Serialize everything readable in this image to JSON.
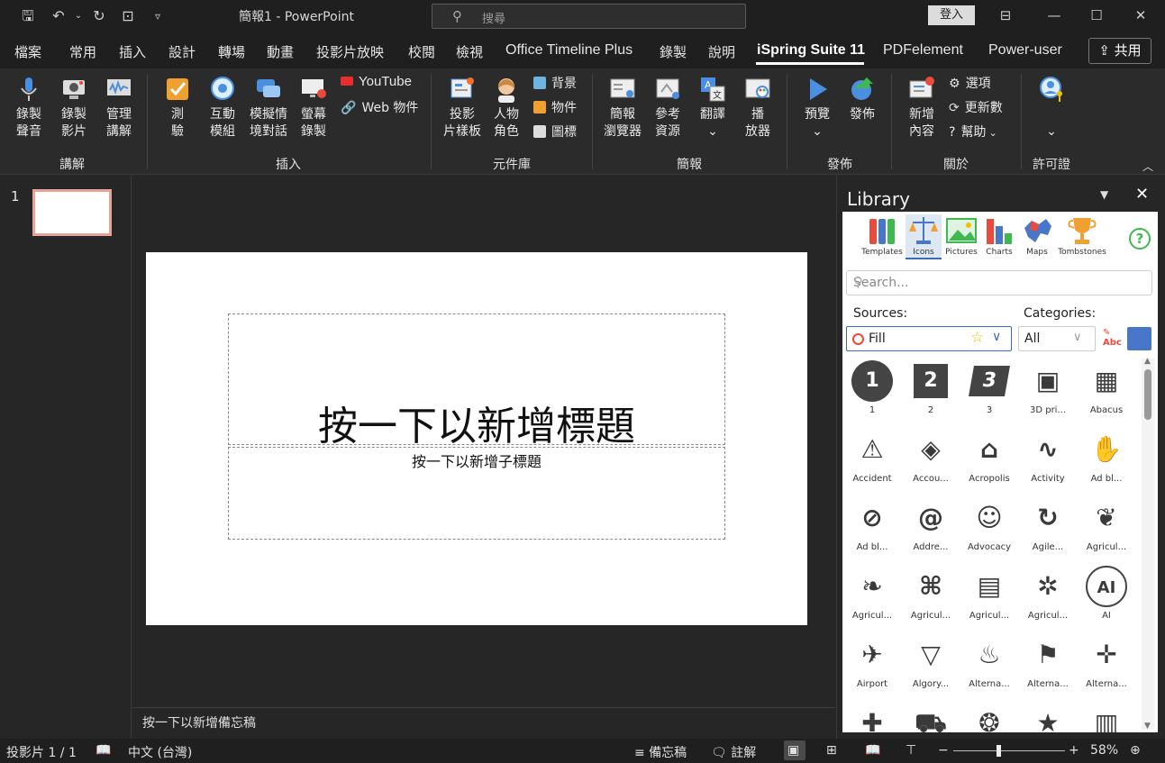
{
  "titlebar": {
    "title": "簡報1  -  PowerPoint",
    "search_placeholder": "搜尋",
    "signin": "登入"
  },
  "menu": {
    "tabs": [
      "檔案",
      "常用",
      "插入",
      "設計",
      "轉場",
      "動畫",
      "投影片放映",
      "校閱",
      "檢視",
      "Office Timeline Plus",
      "錄製",
      "說明",
      "iSpring Suite 11",
      "PDFelement",
      "Power-user"
    ],
    "active": "iSpring Suite 11",
    "share": "共用"
  },
  "ribbon": {
    "groups": {
      "narration": {
        "label": "講解",
        "buttons": [
          [
            "錄製",
            "聲音"
          ],
          [
            "錄製",
            "影片"
          ],
          [
            "管理",
            "講解"
          ]
        ]
      },
      "insert": {
        "label": "插入",
        "buttons": [
          [
            "測",
            "驗"
          ],
          [
            "互動",
            "模組"
          ],
          [
            "模擬情",
            "境對話"
          ],
          [
            "螢幕",
            "錄製"
          ]
        ],
        "small": [
          "YouTube",
          "Web 物件"
        ]
      },
      "library": {
        "label": "元件庫",
        "buttons": [
          [
            "投影",
            "片樣板"
          ],
          [
            "人物",
            "角色"
          ]
        ],
        "small": [
          "背景",
          "物件",
          "圖標"
        ]
      },
      "presentation": {
        "label": "簡報",
        "buttons": [
          [
            "簡報",
            "瀏覽器"
          ],
          [
            "參考",
            "資源"
          ],
          [
            "翻譯",
            ""
          ],
          [
            "播",
            "放器"
          ]
        ]
      },
      "publish": {
        "label": "發佈",
        "buttons": [
          [
            "預覽",
            ""
          ],
          [
            "發佈",
            ""
          ]
        ]
      },
      "about": {
        "label": "關於",
        "buttons": [
          [
            "新增",
            "內容"
          ]
        ],
        "small": [
          "選項",
          "更新數",
          "幫助"
        ]
      },
      "license": {
        "label": "許可證"
      }
    }
  },
  "thumbnails": {
    "number": "1"
  },
  "slide": {
    "title_placeholder": "按一下以新增標題",
    "subtitle_placeholder": "按一下以新增子標題"
  },
  "notes": {
    "placeholder": "按一下以新增備忘稿"
  },
  "library": {
    "title": "Library",
    "tabs": [
      "Templates",
      "Icons",
      "Pictures",
      "Charts",
      "Maps",
      "Tombstones"
    ],
    "active_tab": "Icons",
    "search_placeholder": "Search...",
    "sources_label": "Sources:",
    "categories_label": "Categories:",
    "source_value": "Fill",
    "category_value": "All",
    "accent_color": "#4876c8",
    "icons": [
      {
        "label": "1",
        "glyph": "1"
      },
      {
        "label": "2",
        "glyph": "2"
      },
      {
        "label": "3",
        "glyph": "3"
      },
      {
        "label": "3D pri...",
        "glyph": "▣"
      },
      {
        "label": "Abacus",
        "glyph": "▦"
      },
      {
        "label": "Accident",
        "glyph": "⚠"
      },
      {
        "label": "Accou...",
        "glyph": "◈"
      },
      {
        "label": "Acropolis",
        "glyph": "⌂"
      },
      {
        "label": "Activity",
        "glyph": "∿"
      },
      {
        "label": "Ad bl...",
        "glyph": "✋"
      },
      {
        "label": "Ad bl...",
        "glyph": "⊘"
      },
      {
        "label": "Addre...",
        "glyph": "@"
      },
      {
        "label": "Advocacy",
        "glyph": "☺"
      },
      {
        "label": "Agile...",
        "glyph": "↻"
      },
      {
        "label": "Agricul...",
        "glyph": "❦"
      },
      {
        "label": "Agricul...",
        "glyph": "❧"
      },
      {
        "label": "Agricul...",
        "glyph": "⌘"
      },
      {
        "label": "Agricul...",
        "glyph": "▤"
      },
      {
        "label": "Agricul...",
        "glyph": "✲"
      },
      {
        "label": "AI",
        "glyph": "AI"
      },
      {
        "label": "Airport",
        "glyph": "✈"
      },
      {
        "label": "Algory...",
        "glyph": "▽"
      },
      {
        "label": "Alterna...",
        "glyph": "♨"
      },
      {
        "label": "Alterna...",
        "glyph": "⚑"
      },
      {
        "label": "Alterna...",
        "glyph": "✛"
      },
      {
        "label": "",
        "glyph": "✚"
      },
      {
        "label": "",
        "glyph": "⛟"
      },
      {
        "label": "",
        "glyph": "❂"
      },
      {
        "label": "",
        "glyph": "★"
      },
      {
        "label": "",
        "glyph": "▥"
      }
    ]
  },
  "statusbar": {
    "slide_info": "投影片 1 / 1",
    "language": "中文 (台灣)",
    "notes": "備忘稿",
    "comments": "註解",
    "zoom": "58%",
    "zoom_value": 0.4
  }
}
